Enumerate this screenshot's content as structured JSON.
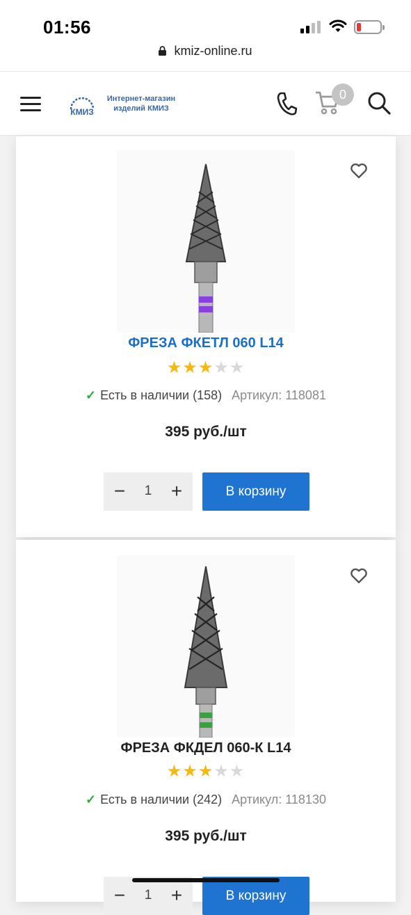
{
  "status_bar": {
    "time": "01:56",
    "battery_level": 0.15,
    "battery_color": "#e53935"
  },
  "browser": {
    "url": "kmiz-online.ru"
  },
  "header": {
    "logo_text_line1": "Интернет-магазин",
    "logo_text_line2": "изделий КМИЗ",
    "logo_mark": "КМИЗ",
    "cart_count": "0",
    "icons": [
      "menu-icon",
      "phone-icon",
      "cart-icon",
      "search-icon"
    ]
  },
  "products": [
    {
      "title": "ФРЕЗА ФКЕТЛ 060 L14",
      "rating": 3,
      "rating_max": 5,
      "stock_label": "Есть в наличии (158)",
      "sku_label": "Артикул: 118081",
      "price": "395 руб./шт",
      "quantity": "1",
      "add_to_cart": "В корзину",
      "band_color": "#8a3fe0"
    },
    {
      "title": "ФРЕЗА ФКДЕЛ 060-К L14",
      "rating": 3,
      "rating_max": 5,
      "stock_label": "Есть в наличии (242)",
      "sku_label": "Артикул: 118130",
      "price": "395 руб./шт",
      "quantity": "1",
      "add_to_cart": "В корзину",
      "band_color": "#3aa040"
    }
  ],
  "colors": {
    "accent": "#1f73d1",
    "title_link": "#1a6fc9",
    "star": "#f5b914",
    "in_stock": "#2eaa3c"
  }
}
